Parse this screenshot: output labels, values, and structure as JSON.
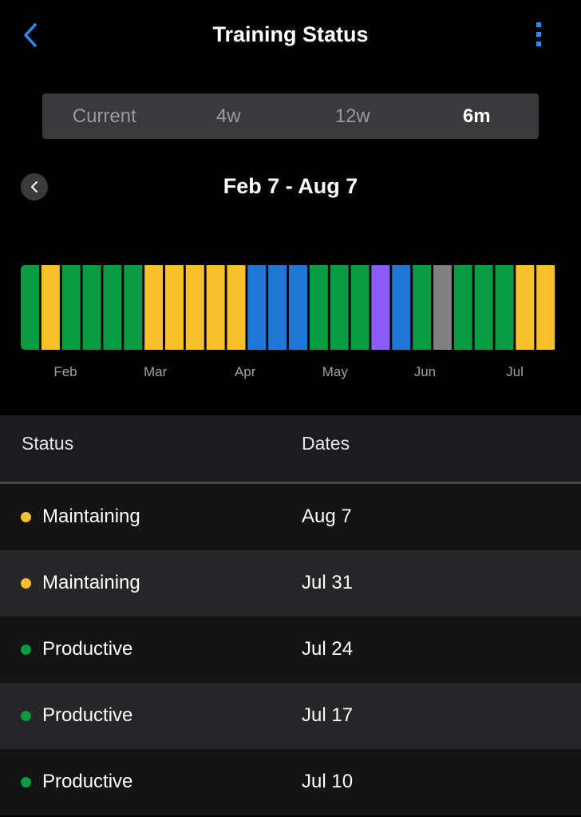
{
  "nav": {
    "title": "Training Status",
    "back_icon": "chevron-left-icon",
    "more_icon": "more-vertical-icon",
    "accent_color": "#2f8cff"
  },
  "range_tabs": [
    {
      "label": "Current",
      "selected": false
    },
    {
      "label": "4w",
      "selected": false
    },
    {
      "label": "12w",
      "selected": false
    },
    {
      "label": "6m",
      "selected": true
    }
  ],
  "range": {
    "label": "Feb 7 - Aug 7",
    "prev_icon": "chevron-left-icon"
  },
  "status_colors": {
    "Productive": "#0a9a41",
    "Maintaining": "#f5c02c",
    "Recovery": "#1f78d6",
    "Peaking": "#8b5cf6",
    "No Status": "#808080"
  },
  "chart_data": {
    "type": "bar",
    "bars": [
      "Productive",
      "Maintaining",
      "Productive",
      "Productive",
      "Productive",
      "Productive",
      "Maintaining",
      "Maintaining",
      "Maintaining",
      "Maintaining",
      "Maintaining",
      "Recovery",
      "Recovery",
      "Recovery",
      "Productive",
      "Productive",
      "Productive",
      "Peaking",
      "Recovery",
      "Productive",
      "No Status",
      "Productive",
      "Productive",
      "Productive",
      "Maintaining",
      "Maintaining"
    ],
    "x_tick_labels": [
      "Feb",
      "Mar",
      "Apr",
      "May",
      "Jun",
      "Jul"
    ]
  },
  "table": {
    "headers": {
      "status": "Status",
      "dates": "Dates"
    },
    "rows": [
      {
        "status": "Maintaining",
        "date": "Aug 7",
        "color": "#f5c02c"
      },
      {
        "status": "Maintaining",
        "date": "Jul 31",
        "color": "#f5c02c"
      },
      {
        "status": "Productive",
        "date": "Jul 24",
        "color": "#0a9a41"
      },
      {
        "status": "Productive",
        "date": "Jul 17",
        "color": "#0a9a41"
      },
      {
        "status": "Productive",
        "date": "Jul 10",
        "color": "#0a9a41"
      }
    ]
  }
}
